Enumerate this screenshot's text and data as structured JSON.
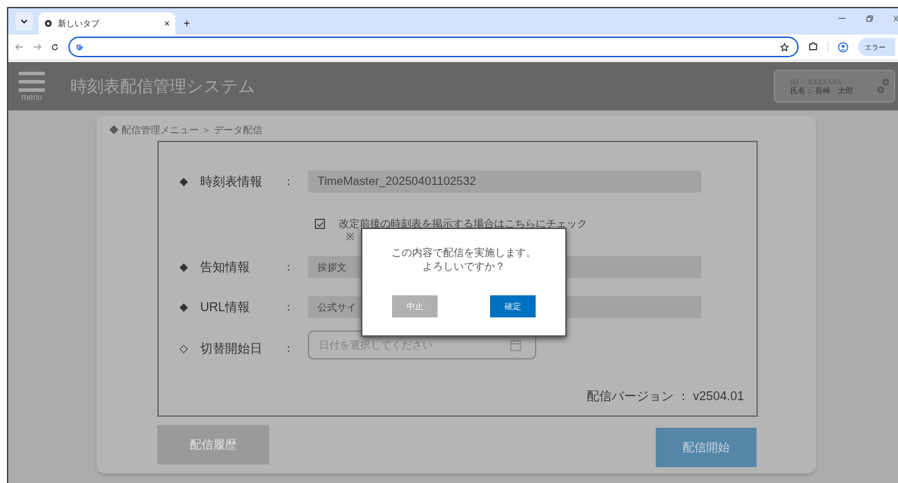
{
  "browser": {
    "tab": {
      "title": "新しいタブ",
      "close": "×"
    },
    "new_tab": "+",
    "profile_button": "エラー"
  },
  "header": {
    "menu_label": "menu",
    "title": "時刻表配信管理システム",
    "user": {
      "id": "ID ：XXXXXXX",
      "name": "氏名： 長崎　太郎"
    }
  },
  "breadcrumb": "◆ 配信管理メニュー ＞ データ配信",
  "form": {
    "fields": [
      {
        "kind": "text",
        "marker": "◆",
        "label": "時刻表情報",
        "colon": "：",
        "value": "TimeMaster_20250401102532",
        "large": true
      },
      {
        "kind": "checkbox",
        "checked": true,
        "label": "改定前後の時刻表を掲示する場合はこちらにチェック",
        "note": "※"
      },
      {
        "kind": "text",
        "marker": "◆",
        "label": "告知情報",
        "colon": "：",
        "value": "挨拶文",
        "large": false
      },
      {
        "kind": "text",
        "marker": "◆",
        "label": "URL情報",
        "colon": "：",
        "value": "公式サイ",
        "large": false
      },
      {
        "kind": "date",
        "marker": "◇",
        "label": "切替開始日",
        "colon": "：",
        "placeholder": "日付を選択してください"
      }
    ],
    "version": "配信バージョン ： v2504.01"
  },
  "buttons": [
    {
      "kind": "secondary",
      "label": "配信履歴"
    },
    {
      "kind": "primary",
      "label": "配信開始"
    }
  ],
  "dialog": {
    "message": [
      "この内容で配信を実施します。",
      "よろしいですか？"
    ],
    "buttons": [
      {
        "kind": "cancel",
        "label": "中止"
      },
      {
        "kind": "confirm",
        "label": "確定"
      }
    ]
  }
}
